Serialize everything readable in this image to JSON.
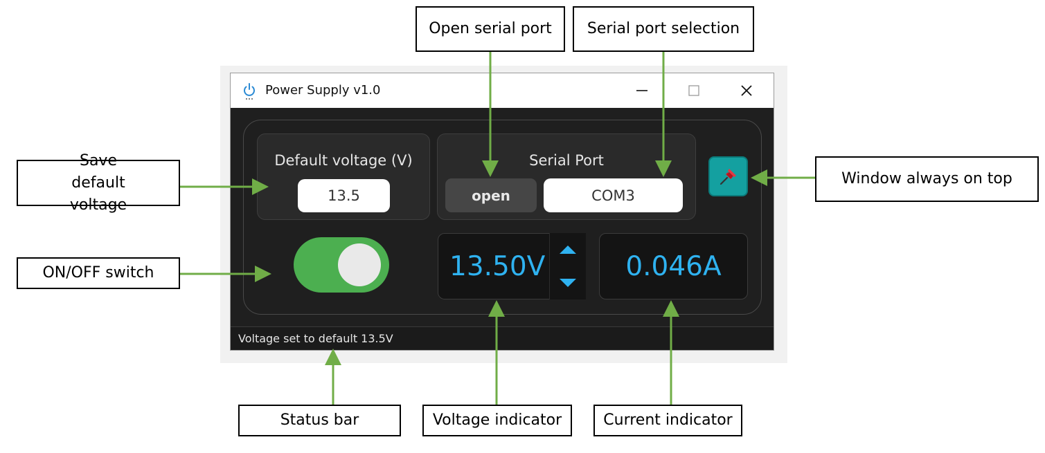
{
  "window": {
    "title": "Power Supply v1.0",
    "minimize_glyph": "—",
    "maximize_glyph": "☐",
    "close_glyph": "✕"
  },
  "default_voltage": {
    "label": "Default voltage (V)",
    "value": "13.5"
  },
  "serial_port": {
    "label": "Serial Port",
    "open_label": "open",
    "selected_port": "COM3"
  },
  "pin_button": {
    "icon": "pushpin-icon",
    "active": true
  },
  "power_switch": {
    "state": "on"
  },
  "voltage_display": {
    "value": "13.50V"
  },
  "current_display": {
    "value": "0.046A"
  },
  "status_bar": {
    "text": "Voltage set to default 13.5V"
  },
  "callouts": {
    "open_serial_port": "Open serial port",
    "serial_port_selection": "Serial port selection",
    "save_default_voltage": "Save default voltage",
    "window_always_on_top": "Window always on top",
    "on_off_switch": "ON/OFF switch",
    "status_bar": "Status bar",
    "voltage_indicator": "Voltage indicator",
    "current_indicator": "Current indicator"
  },
  "colors": {
    "accent_blue": "#2fb2f0",
    "switch_green": "#4caf50",
    "pin_teal": "#14a0a0",
    "arrow_green": "#70ad47",
    "window_bg": "#1f1f1f"
  }
}
